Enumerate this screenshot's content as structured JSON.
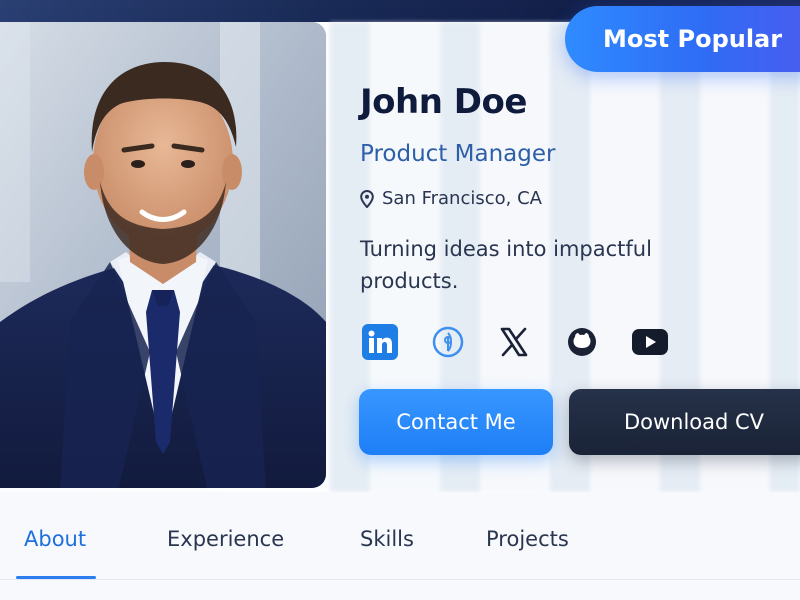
{
  "ribbon": {
    "label": "Most Popular"
  },
  "profile": {
    "name": "John Doe",
    "role": "Product Manager",
    "location": "San Francisco, CA",
    "bio": "Turning ideas into impactful products."
  },
  "socials": [
    {
      "icon": "linkedin-icon"
    },
    {
      "icon": "globe-icon"
    },
    {
      "icon": "x-icon"
    },
    {
      "icon": "github-icon"
    },
    {
      "icon": "youtube-icon"
    }
  ],
  "actions": {
    "contact_label": "Contact Me",
    "download_label": "Download CV"
  },
  "tabs": [
    {
      "label": "About",
      "active": true
    },
    {
      "label": "Experience",
      "active": false
    },
    {
      "label": "Skills",
      "active": false
    },
    {
      "label": "Projects",
      "active": false
    }
  ],
  "colors": {
    "accent": "#1e7ef6",
    "dark_button": "#1a2336",
    "name_text": "#0f1b3d",
    "role_text": "#2d5fa8"
  }
}
